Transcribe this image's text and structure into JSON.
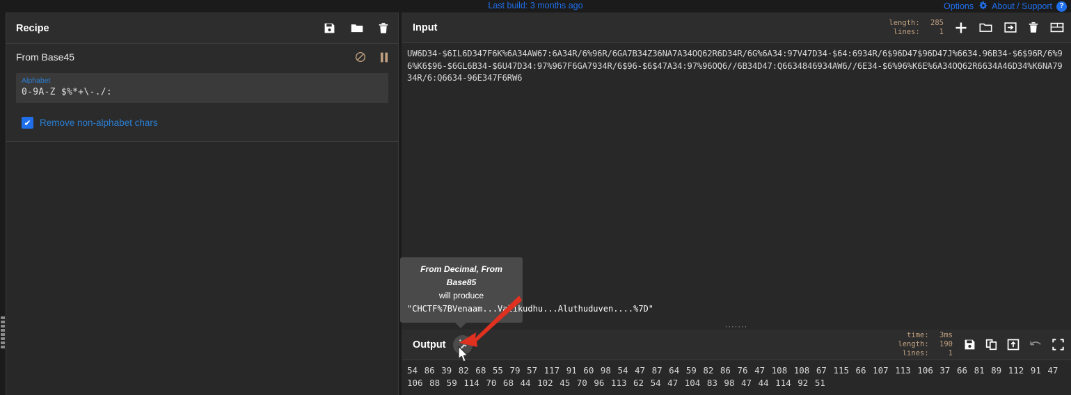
{
  "banner": {
    "build_msg": "Last build: 3 months ago",
    "options_label": "Options",
    "about_label": "About / Support",
    "gear_icon": "gear-icon",
    "help_icon": "?"
  },
  "recipe": {
    "title": "Recipe",
    "icons": [
      "save-icon",
      "folder-icon",
      "trash-icon"
    ],
    "operations": [
      {
        "name": "From Base45",
        "disable_icon": "ban-icon",
        "pause_icon": "pause-icon",
        "args": [
          {
            "label": "Alphabet",
            "value": "0-9A-Z $%*+\\-./:"
          }
        ],
        "checkbox": {
          "label": "Remove non-alphabet chars",
          "checked": true,
          "mark": "✔"
        }
      }
    ]
  },
  "input": {
    "title": "Input",
    "status": {
      "length_key": "length:",
      "length_val": "285",
      "lines_key": "lines:",
      "lines_val": "1"
    },
    "icons": [
      "plus-icon",
      "folder-open-icon",
      "import-icon",
      "trash-icon",
      "tabs-icon"
    ],
    "text": "UW6D34-$6IL6D347F6K%6A34AW67:6A34R/6%96R/6GA7B34Z36NA7A34OQ62R6D34R/6G%6A34:97V47D34-$64:6934R/6$96D47$96D47J%6634.96B34-$6$96R/6%96%K6$96-$6GL6B34-$6U47D34:97%967F6GA7934R/6$96-$6$47A34:97%96OQ6//6B34D47:Q6634846934AW6//6E34-$6%96%K6E%6A34OQ62R6634A46D34%K6NA7934R/6:Q6634-96E347F6RW6"
  },
  "splitter": {
    "grip": "·······"
  },
  "output": {
    "title": "Output",
    "magic_icon": "magic-wand-icon",
    "status": {
      "time_key": "time:",
      "time_val": "3ms",
      "length_key": "length:",
      "length_val": "190",
      "lines_key": "lines:",
      "lines_val": "1"
    },
    "icons": [
      "save-icon",
      "copy-icon",
      "replace-input-icon",
      "undo-icon",
      "maximise-icon"
    ],
    "text": "54 86 39 82 68 55 79 57 117 91 60 98 54 47 87 64 59 82 86 76 47 108 108 67 115 66 107 113 106 37 66 81 89 112 91 47 106 88 59 114 70 68 44 102 45 70 96 113 62 54 47 104 83 98 47 44 114 92 51"
  },
  "tooltip": {
    "op_names": "From Decimal, From Base85",
    "will_produce": "will produce",
    "result": "\"CHCTF%7BVenaam...Valikudhu...Aluthuduven....%7D\""
  },
  "annotation": {
    "arrow_color": "#e03020"
  },
  "colors": {
    "accent_blue": "#1f6feb",
    "link_blue": "#2a7fd4",
    "op_control_tan": "#c0a080",
    "pane_bg": "#282828",
    "header_bg": "#2d2d2d",
    "page_bg": "#1b1b1b"
  }
}
